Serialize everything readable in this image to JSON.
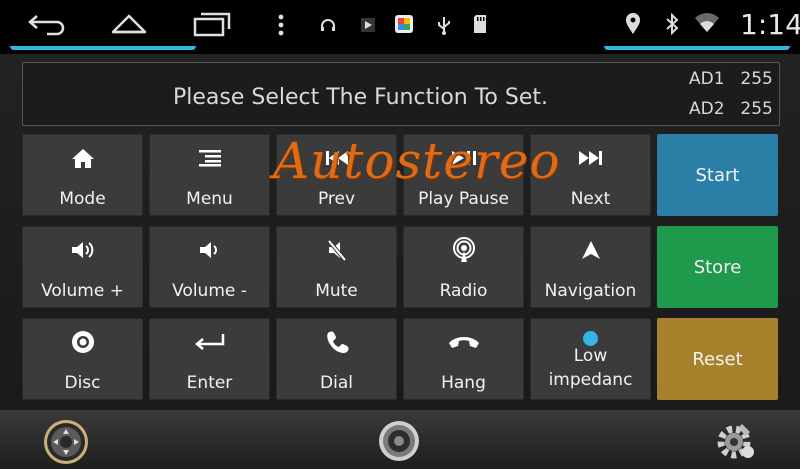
{
  "status_bar": {
    "time": "1:14",
    "icons": [
      "back-icon",
      "home-icon",
      "recents-icon",
      "overflow-menu-icon",
      "headset-icon",
      "play-store-icon",
      "photos-icon",
      "usb-icon",
      "sd-card-icon",
      "location-icon",
      "bluetooth-icon",
      "wifi-icon"
    ],
    "accent_color": "#33b5e5"
  },
  "info_panel": {
    "prompt": "Please Select The Function To Set.",
    "ad1_label": "AD1",
    "ad1_value": "255",
    "ad2_label": "AD2",
    "ad2_value": "255"
  },
  "watermark": "Autostereo",
  "buttons": {
    "mode": "Mode",
    "menu": "Menu",
    "prev": "Prev",
    "play_pause": "Play Pause",
    "next": "Next",
    "start": "Start",
    "volume_up": "Volume +",
    "volume_down": "Volume -",
    "mute": "Mute",
    "radio": "Radio",
    "navigation": "Navigation",
    "store": "Store",
    "disc": "Disc",
    "enter": "Enter",
    "dial": "Dial",
    "hang": "Hang",
    "low_impedance_line1": "Low",
    "low_impedance_line2": "impedanc",
    "reset": "Reset"
  },
  "colors": {
    "start": "#2b7fa6",
    "store": "#1f9a4d",
    "reset": "#a8812c",
    "tile": "#3b3b3b",
    "indicator": "#33b5e5",
    "watermark": "#e06a16"
  },
  "bottom_bar": {
    "icons": [
      "joystick-icon",
      "speaker-icon",
      "settings-gear-icon"
    ]
  }
}
